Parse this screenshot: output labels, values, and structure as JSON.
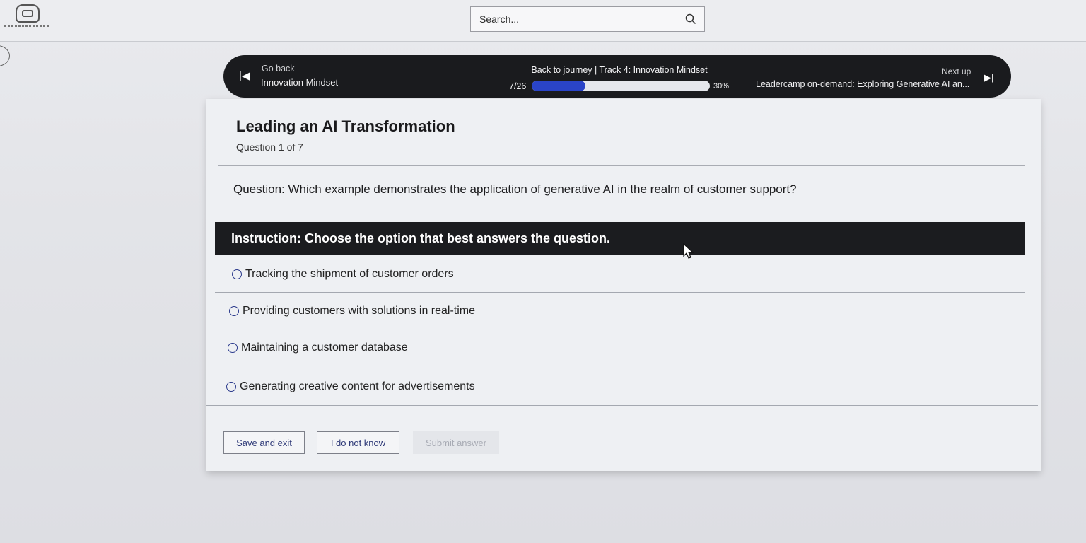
{
  "header": {
    "search_placeholder": "Search..."
  },
  "nav": {
    "go_back_label": "Go back",
    "previous_title": "Innovation Mindset",
    "back_to_journey": "Back to journey  |  Track 4: Innovation Mindset",
    "progress_count": "7/26",
    "progress_percent": "30%",
    "progress_value": 0.3,
    "next_up_label": "Next up",
    "next_title": "Leadercamp on-demand: Exploring Generative AI an..."
  },
  "quiz": {
    "title": "Leading an AI Transformation",
    "question_counter": "Question 1 of 7",
    "question_label": "Question",
    "question_text": ": Which example demonstrates the application of generative AI in the realm of customer support?",
    "instruction": "Instruction: Choose the option that best answers the question.",
    "options": [
      "Tracking the shipment of customer orders",
      "Providing customers with solutions in real-time",
      "Maintaining a customer database",
      "Generating creative content for advertisements"
    ]
  },
  "actions": {
    "save_exit": "Save and exit",
    "do_not_know": "I do not know",
    "submit": "Submit answer"
  },
  "colors": {
    "accent": "#2a44c8",
    "dark_bar": "#1b1c1f"
  }
}
